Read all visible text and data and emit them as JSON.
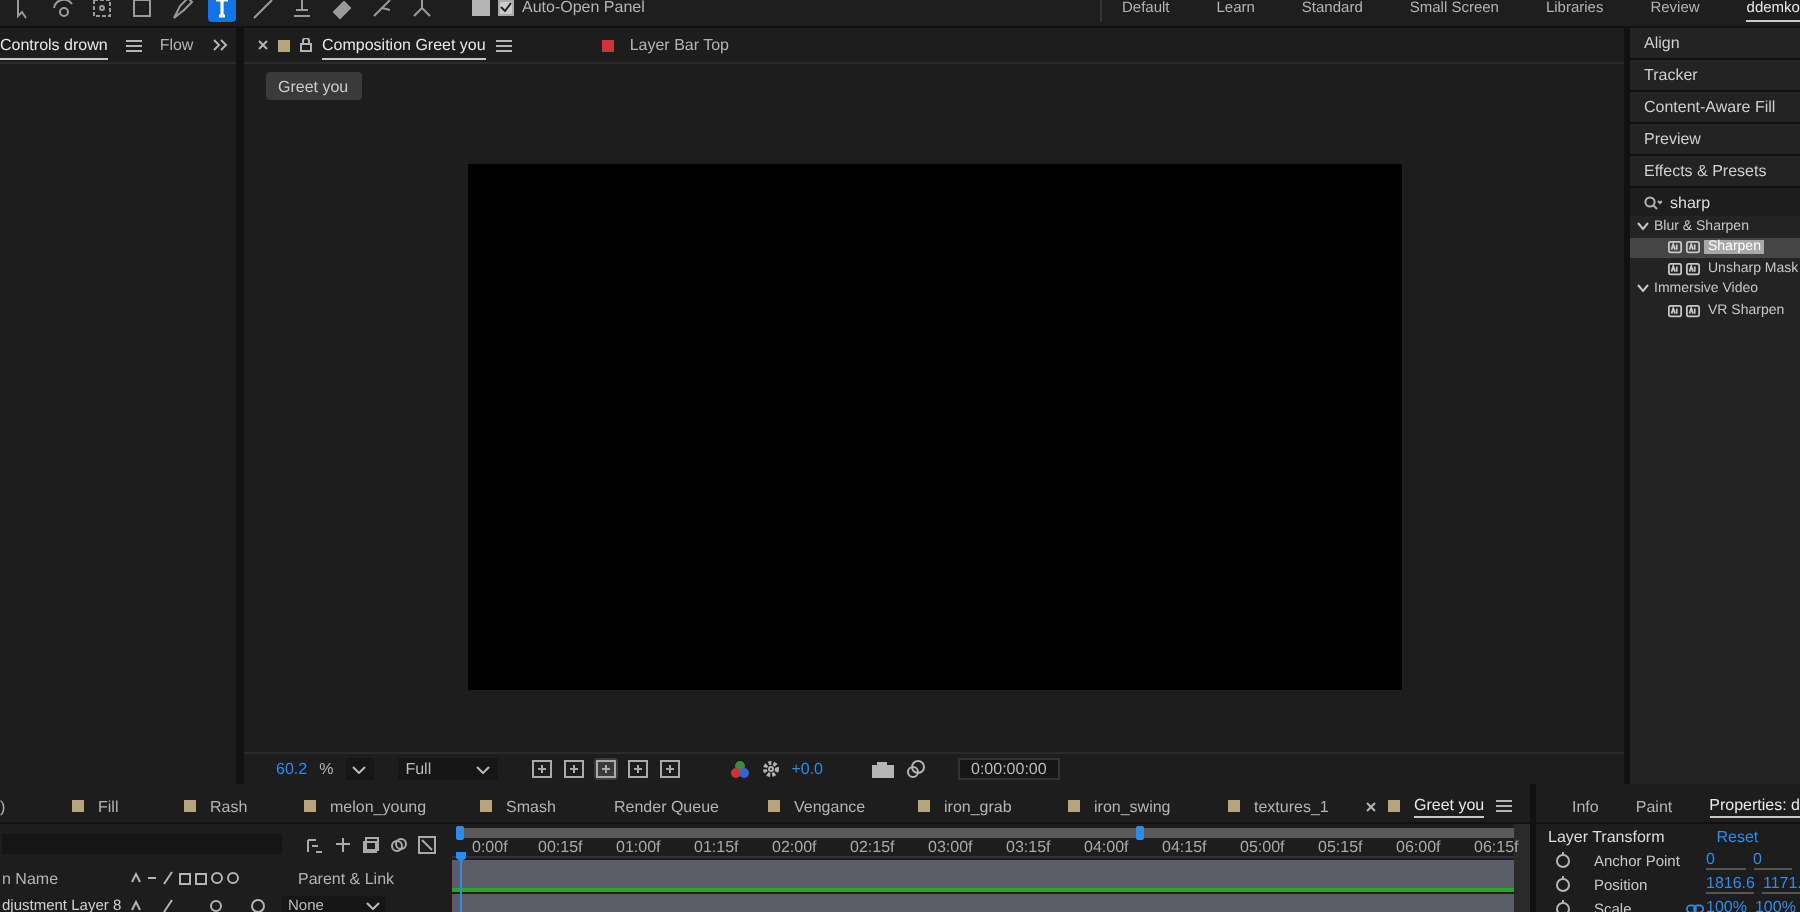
{
  "toolbar": {
    "tools": [
      {
        "kind": "arrow",
        "selected": false
      },
      {
        "kind": "orbit",
        "selected": false
      },
      {
        "kind": "anchor",
        "selected": false
      },
      {
        "kind": "rectangle",
        "selected": false
      },
      {
        "kind": "pen",
        "selected": false
      },
      {
        "kind": "type",
        "selected": true
      },
      {
        "kind": "brush",
        "selected": false
      },
      {
        "kind": "stamp",
        "selected": false
      },
      {
        "kind": "eraser",
        "selected": false
      },
      {
        "kind": "roto",
        "selected": false
      },
      {
        "kind": "puppet",
        "selected": false
      }
    ],
    "auto_open_panel": {
      "label": "Auto-Open Panel",
      "checked": true
    }
  },
  "workspaces": [
    {
      "label": "Default",
      "selected": false
    },
    {
      "label": "Learn",
      "selected": false
    },
    {
      "label": "Standard",
      "selected": false
    },
    {
      "label": "Small Screen",
      "selected": false
    },
    {
      "label": "Libraries",
      "selected": false
    },
    {
      "label": "Review",
      "selected": false
    },
    {
      "label": "ddemko",
      "selected": true
    }
  ],
  "left_panel": {
    "tabs": [
      {
        "label": "Controls drown",
        "selected": true
      },
      {
        "label": "Flow",
        "selected": false
      }
    ]
  },
  "composition_panel": {
    "tabs": [
      {
        "label": "Composition Greet you",
        "selected": true,
        "locked": true,
        "color": "#b5a47c"
      },
      {
        "label": "Layer Bar Top",
        "selected": false,
        "locked": false,
        "color": "#d0323c"
      }
    ],
    "breadcrumb": "Greet you",
    "footer": {
      "zoom": "60.2",
      "zoom_unit": "%",
      "resolution": "Full",
      "exposure": "+0.0",
      "timecode": "0:00:00:00"
    }
  },
  "effects_panel": {
    "panels": [
      "Align",
      "Tracker",
      "Content-Aware Fill",
      "Preview",
      "Effects & Presets"
    ],
    "search": "sharp",
    "tree": [
      {
        "label": "Blur & Sharpen",
        "expanded": true,
        "children": [
          {
            "label": "Sharpen",
            "selected": true
          },
          {
            "label": "Unsharp Mask",
            "selected": false
          }
        ]
      },
      {
        "label": "Immersive Video",
        "expanded": true,
        "children": [
          {
            "label": "VR Sharpen",
            "selected": false
          }
        ]
      }
    ]
  },
  "timeline": {
    "tabs": [
      {
        "label": ")",
        "selected": false
      },
      {
        "label": "Fill",
        "selected": false,
        "color": "#b5a47c"
      },
      {
        "label": "Rash",
        "selected": false,
        "color": "#b5a47c"
      },
      {
        "label": "melon_young",
        "selected": false,
        "color": "#b5a47c"
      },
      {
        "label": "Smash",
        "selected": false,
        "color": "#b5a47c"
      },
      {
        "label": "Render Queue",
        "selected": false
      },
      {
        "label": "Vengance",
        "selected": false,
        "color": "#b5a47c"
      },
      {
        "label": "iron_grab",
        "selected": false,
        "color": "#b5a47c"
      },
      {
        "label": "iron_swing",
        "selected": false,
        "color": "#b5a47c"
      },
      {
        "label": "textures_1",
        "selected": false,
        "color": "#b5a47c"
      },
      {
        "label": "Greet you",
        "selected": true,
        "color": "#b5a47c"
      }
    ],
    "columns": [
      "n Name",
      "Parent & Link"
    ],
    "layers": [
      {
        "name": "djustment Layer 8",
        "parent": "None"
      }
    ],
    "ruler": [
      "0:00f",
      "00:15f",
      "01:00f",
      "01:15f",
      "02:00f",
      "02:15f",
      "03:00f",
      "03:15f",
      "04:00f",
      "04:15f",
      "05:00f",
      "05:15f",
      "06:00f",
      "06:15f"
    ]
  },
  "properties_panel": {
    "tabs": [
      {
        "label": "Info",
        "selected": false
      },
      {
        "label": "Paint",
        "selected": false
      },
      {
        "label": "Properties: d",
        "selected": true
      }
    ],
    "section": "Layer Transform",
    "reset": "Reset",
    "rows": [
      {
        "label": "Anchor Point",
        "values": [
          "0",
          "0"
        ],
        "linked": false
      },
      {
        "label": "Position",
        "values": [
          "1816.6",
          "1171."
        ],
        "linked": false
      },
      {
        "label": "Scale",
        "values": [
          "100%",
          "100%"
        ],
        "linked": true
      }
    ]
  }
}
